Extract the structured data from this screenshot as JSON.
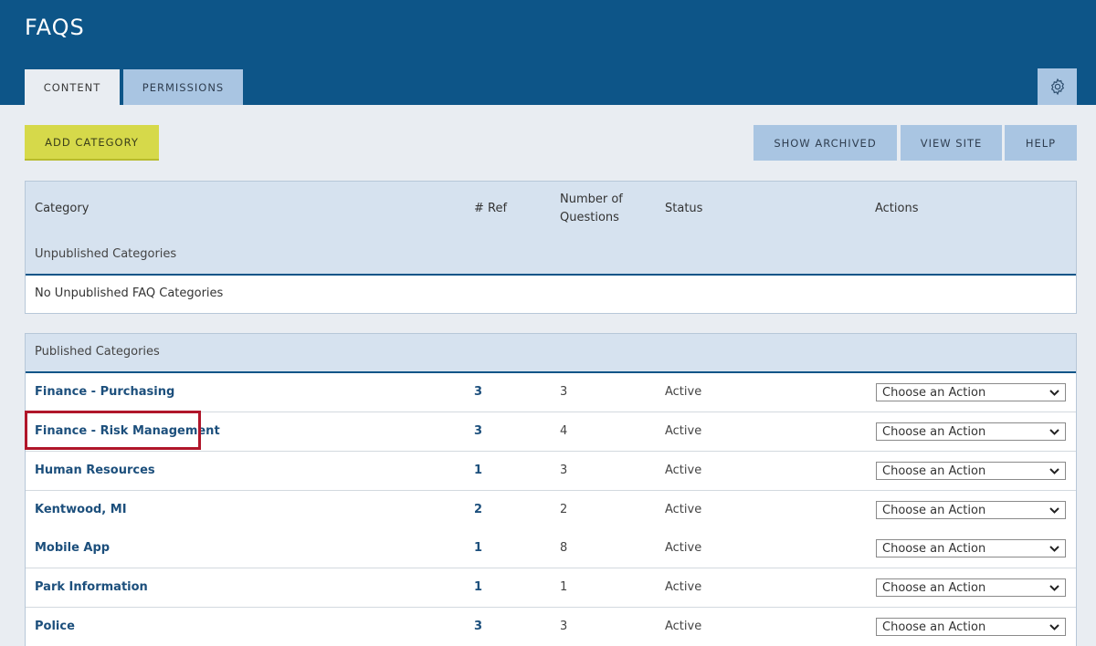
{
  "header": {
    "title": "FAQS",
    "tabs": [
      {
        "label": "CONTENT",
        "active": true
      },
      {
        "label": "PERMISSIONS",
        "active": false
      }
    ],
    "settings_icon": "gear-icon"
  },
  "toolbar": {
    "add_label": "ADD CATEGORY",
    "show_archived_label": "SHOW ARCHIVED",
    "view_site_label": "VIEW SITE",
    "help_label": "HELP"
  },
  "table": {
    "columns": [
      "Category",
      "# Ref",
      "Number of Questions",
      "Status",
      "Actions"
    ],
    "column_number_line1": "Number of",
    "column_number_line2": "Questions"
  },
  "unpublished": {
    "label": "Unpublished Categories",
    "empty_message": "No Unpublished FAQ Categories"
  },
  "published": {
    "label": "Published Categories",
    "rows": [
      {
        "name": "Finance - Purchasing",
        "ref": "3",
        "questions": "3",
        "status": "Active",
        "action": "Choose an Action"
      },
      {
        "name": "Finance - Risk Management",
        "ref": "3",
        "questions": "4",
        "status": "Active",
        "action": "Choose an Action"
      },
      {
        "name": "Human Resources",
        "ref": "1",
        "questions": "3",
        "status": "Active",
        "action": "Choose an Action"
      },
      {
        "name": "Kentwood, MI",
        "ref": "2",
        "questions": "2",
        "status": "Active",
        "action": "Choose an Action"
      },
      {
        "name": "Mobile App",
        "ref": "1",
        "questions": "8",
        "status": "Active",
        "action": "Choose an Action"
      },
      {
        "name": "Park Information",
        "ref": "1",
        "questions": "1",
        "status": "Active",
        "action": "Choose an Action"
      },
      {
        "name": "Police",
        "ref": "3",
        "questions": "3",
        "status": "Active",
        "action": "Choose an Action"
      }
    ]
  },
  "colors": {
    "header_bg": "#0d5588",
    "tab_bg": "#a9c5e2",
    "add_button": "#d6d94a",
    "link": "#1c4f7c",
    "highlight": "#b0162a"
  }
}
